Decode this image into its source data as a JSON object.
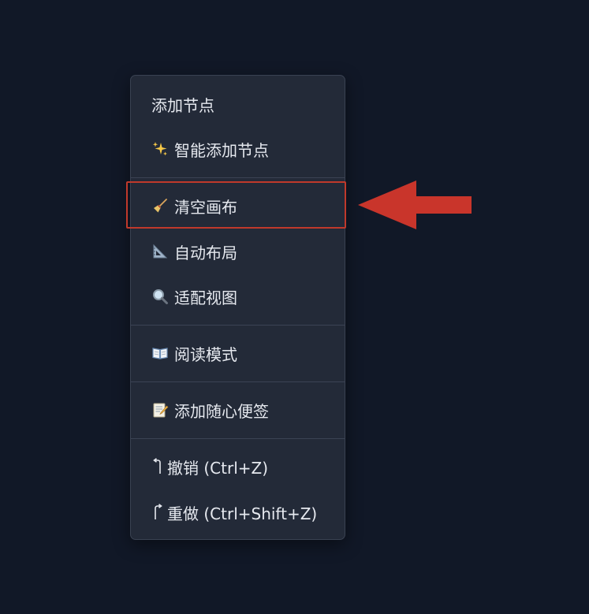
{
  "menu": {
    "items": [
      {
        "label": "添加节点",
        "icon": ""
      },
      {
        "label": "智能添加节点",
        "icon": "sparkles-icon"
      },
      {
        "label": "清空画布",
        "icon": "broom-icon"
      },
      {
        "label": "自动布局",
        "icon": "triangular-ruler-icon"
      },
      {
        "label": "适配视图",
        "icon": "magnifying-glass-icon"
      },
      {
        "label": "阅读模式",
        "icon": "open-book-icon"
      },
      {
        "label": "添加随心便签",
        "icon": "memo-icon"
      },
      {
        "label": "撤销 (Ctrl+Z)",
        "icon": "undo-arrow-icon"
      },
      {
        "label": "重做 (Ctrl+Shift+Z)",
        "icon": "redo-arrow-icon"
      }
    ]
  },
  "annotation": {
    "color": "#c0392b",
    "highlighted_item": "清空画布"
  },
  "colors": {
    "background": "#111827",
    "menu_background": "#232a38",
    "menu_border": "#3a4252",
    "text": "#e6e9ef",
    "separator": "#3b4354"
  }
}
